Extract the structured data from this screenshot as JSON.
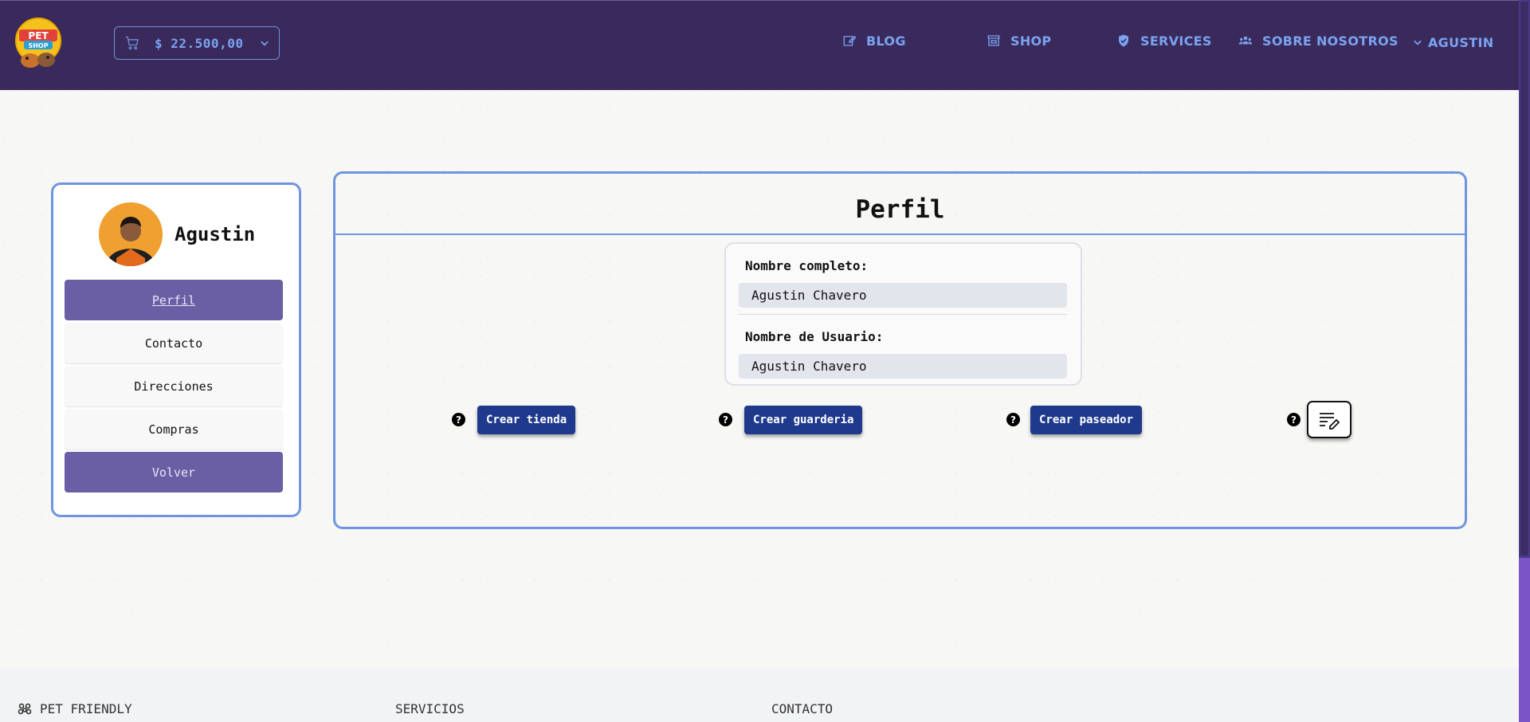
{
  "header": {
    "logo_text_top": "PET",
    "logo_text_bottom": "SHOP",
    "cart_amount": "$ 22.500,00",
    "nav": [
      {
        "label": "BLOG",
        "icon": "edit-icon"
      },
      {
        "label": "SHOP",
        "icon": "store-icon"
      },
      {
        "label": "SERVICES",
        "icon": "shield-icon"
      },
      {
        "label": "SOBRE NOSOTROS",
        "icon": "users-icon"
      },
      {
        "label": "AGUSTIN",
        "icon": "chevron-down-icon"
      }
    ],
    "accent": "#7aa2f0",
    "bg": "#3a2a5c"
  },
  "sidebar": {
    "username": "Agustin",
    "items": [
      {
        "label": "Perfil",
        "active": true
      },
      {
        "label": "Contacto"
      },
      {
        "label": "Direcciones"
      },
      {
        "label": "Compras"
      },
      {
        "label": "Volver"
      }
    ]
  },
  "main": {
    "title": "Perfil",
    "fields": [
      {
        "label": "Nombre completo:",
        "value": "Agustin Chavero"
      },
      {
        "label": "Nombre de Usuario:",
        "value": "Agustin Chavero"
      }
    ],
    "actions": [
      {
        "label": "Crear tienda",
        "help": "?"
      },
      {
        "label": "Crear guarderia",
        "help": "?"
      },
      {
        "label": "Crear paseador",
        "help": "?"
      },
      {
        "label": "",
        "help": "?",
        "icon": "edit-notes-icon"
      }
    ]
  },
  "footer": {
    "columns": [
      "PET FRIENDLY",
      "SERVICIOS",
      "CONTACTO"
    ]
  },
  "colors": {
    "card_border": "#6f95e0",
    "button_primary": "#1f3a8c",
    "sidebar_active": "#6a5fa4"
  }
}
